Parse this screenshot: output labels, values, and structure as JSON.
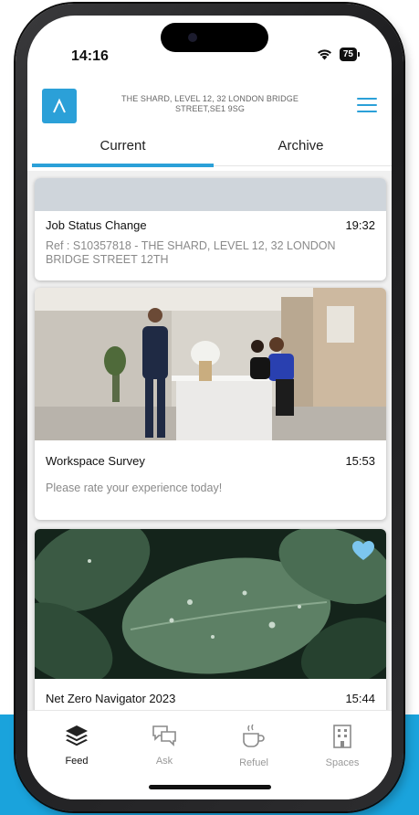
{
  "status_bar": {
    "time": "14:16",
    "battery": "75",
    "icons": [
      "wifi-icon",
      "battery-icon"
    ]
  },
  "header": {
    "logo_icon": "chevron-up-logo",
    "address_line1": "THE SHARD, LEVEL 12, 32 LONDON BRIDGE",
    "address_line2": "STREET,SE1 9SG",
    "menu_icon": "hamburger-menu-icon"
  },
  "tabs": [
    {
      "label": "Current",
      "active": true
    },
    {
      "label": "Archive",
      "active": false
    }
  ],
  "feed": [
    {
      "title": "Job Status Change",
      "time": "19:32",
      "subtitle": "Ref : S10357818 - THE SHARD, LEVEL 12, 32 LONDON BRIDGE STREET 12TH"
    },
    {
      "title": "Workspace Survey",
      "time": "15:53",
      "subtitle": "Please rate your experience today!",
      "image": "office-reception-photo"
    },
    {
      "title": "Net Zero Navigator 2023",
      "time": "15:44",
      "image": "leaves-with-water-droplets-photo",
      "favorite_icon": "heart-icon"
    }
  ],
  "bottom_nav": [
    {
      "label": "Feed",
      "icon": "layers-icon",
      "active": true
    },
    {
      "label": "Ask",
      "icon": "chat-bubbles-icon",
      "active": false
    },
    {
      "label": "Refuel",
      "icon": "coffee-cup-icon",
      "active": false
    },
    {
      "label": "Spaces",
      "icon": "building-icon",
      "active": false
    }
  ],
  "colors": {
    "accent": "#2ba0d8",
    "band": "#1aa3dc"
  }
}
